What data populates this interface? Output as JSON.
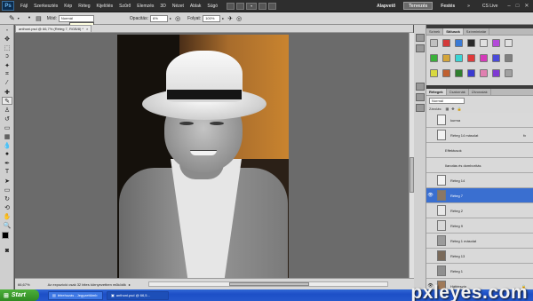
{
  "app": {
    "logo": "Ps"
  },
  "menu": [
    "Fájl",
    "Szerkesztés",
    "Kép",
    "Réteg",
    "Kijelölés",
    "Szűrő",
    "Elemzés",
    "3D",
    "Nézet",
    "Ablak",
    "Súgó"
  ],
  "workspace": {
    "items": [
      "Alapvető",
      "Tervezés",
      "Festés"
    ],
    "active": "Tervezés",
    "overflow": "»",
    "cslive": "CS Live"
  },
  "options": {
    "mode_label": "Mód:",
    "mode_value": "Normál",
    "opacity_label": "Opacitás:",
    "opacity_value": "6%",
    "flow_label": "Folyat:",
    "flow_value": "100%",
    "tooltip": "Festési mód"
  },
  "document": {
    "tab_title": "anthoni.psd @ 66,7% (Réteg 7, RGB/8) *",
    "zoom": "66,67%",
    "status_text": "Az expozíció csak 32 bites környezetben működik"
  },
  "panels": {
    "top_tabs": [
      "Színek",
      "Stílusok",
      "Színmintatár"
    ],
    "top_active": "Stílusok",
    "layer_tabs": [
      "Rétegek",
      "Csatornák",
      "Útvonalak"
    ],
    "layer_active": "Rétegek",
    "blend_mode": "Normál",
    "lock_label": "Zárolás:",
    "style_colors": [
      "#c0c0c0",
      "#d43a3a",
      "#3a7ad4",
      "#2a2a2a",
      "#e0e0e0",
      "#b34ad9",
      "#e0e0e0",
      "#3ab03a",
      "#d4a53a",
      "#3ad4d4",
      "#e03a3a",
      "#d43ab9",
      "#4a4ad9",
      "#808080",
      "#d9d940",
      "#c06030",
      "#2f7f2f",
      "#3a3ad0",
      "#e07fb0",
      "#7f3ad4",
      "#a0a0a0"
    ]
  },
  "layers": [
    {
      "name": "kurma",
      "visible": false,
      "selected": false,
      "thumb": "#f2f2f2",
      "fx": false
    },
    {
      "name": "Réteg 14 másolat",
      "visible": false,
      "selected": false,
      "thumb": "#f2f2f2",
      "fx": true
    },
    {
      "name": "Effektusok",
      "visible": false,
      "selected": false,
      "thumb": "",
      "fx": false,
      "sub": true
    },
    {
      "name": "Ilanotás és domborítás",
      "visible": false,
      "selected": false,
      "thumb": "",
      "fx": false,
      "sub": true
    },
    {
      "name": "Réteg 14",
      "visible": false,
      "selected": false,
      "thumb": "#f2f2f2",
      "fx": false
    },
    {
      "name": "Réteg 7",
      "visible": true,
      "selected": true,
      "thumb": "#8a7764",
      "fx": false
    },
    {
      "name": "Réteg 2",
      "visible": false,
      "selected": false,
      "thumb": "#e8e8e8",
      "fx": false
    },
    {
      "name": "Réteg 9",
      "visible": false,
      "selected": false,
      "thumb": "#d8d8d8",
      "fx": false
    },
    {
      "name": "Réteg 1 másolat",
      "visible": false,
      "selected": false,
      "thumb": "#9b9b9b",
      "fx": false
    },
    {
      "name": "Réteg 13",
      "visible": false,
      "selected": false,
      "thumb": "#7a6a5a",
      "fx": false
    },
    {
      "name": "Réteg 1",
      "visible": false,
      "selected": false,
      "thumb": "#8f8f8f",
      "fx": false
    },
    {
      "name": "Háttérszín",
      "visible": true,
      "selected": false,
      "thumb": "#a07a5a",
      "fx": false,
      "locked": true
    }
  ],
  "taskbar": {
    "start": "Start",
    "tasks": [
      "létrehozás - Jegyzettömb",
      "anthoni.psd @ 66,5..."
    ],
    "watermark": "pxleyes.com"
  }
}
